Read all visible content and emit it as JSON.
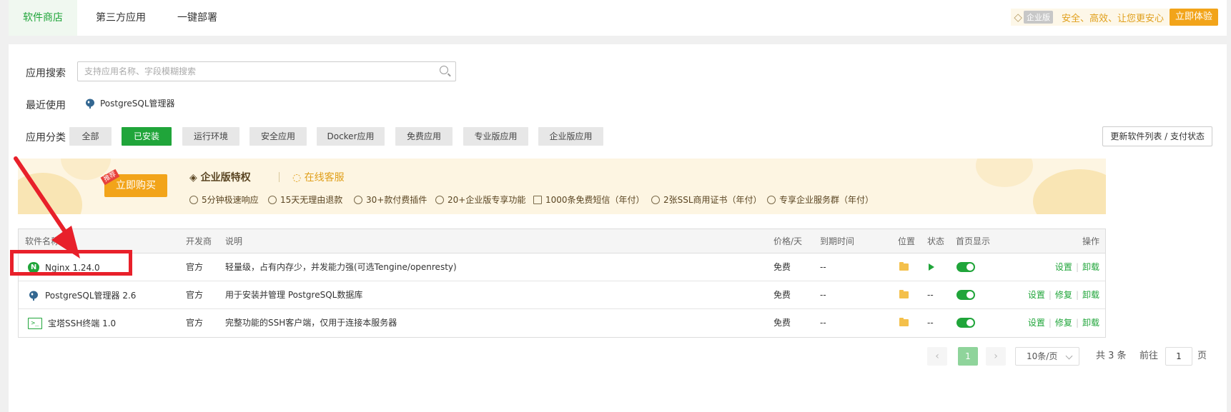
{
  "tabs": [
    {
      "label": "软件商店"
    },
    {
      "label": "第三方应用"
    },
    {
      "label": "一键部署"
    }
  ],
  "promo": {
    "badge_label": "企业版",
    "slogan": "安全、高效、让您更安心",
    "try_label": "立即体验"
  },
  "search": {
    "label": "应用搜索",
    "placeholder": "支持应用名称、字段模糊搜索"
  },
  "recent": {
    "label": "最近使用",
    "items": [
      {
        "name": "PostgreSQL管理器"
      }
    ]
  },
  "categories": {
    "label": "应用分类",
    "items": [
      {
        "label": "全部"
      },
      {
        "label": "已安装",
        "active": true
      },
      {
        "label": "运行环境"
      },
      {
        "label": "安全应用"
      },
      {
        "label": "Docker应用"
      },
      {
        "label": "免费应用"
      },
      {
        "label": "专业版应用"
      },
      {
        "label": "企业版应用"
      }
    ],
    "update_label": "更新软件列表 / 支付状态"
  },
  "banner": {
    "buy_label": "立即购买",
    "hot_tag": "推荐",
    "title": "企业版特权",
    "cs_label": "在线客服",
    "features": [
      "5分钟极速响应",
      "15天无理由退款",
      "30+款付费插件",
      "20+企业版专享功能",
      "1000条免费短信（年付）",
      "2张SSL商用证书（年付）",
      "专享企业服务群（年付）"
    ]
  },
  "table": {
    "headers": {
      "name": "软件名称",
      "developer": "开发商",
      "description": "说明",
      "price": "价格/天",
      "expire": "到期时间",
      "location": "位置",
      "status": "状态",
      "homepage": "首页显示",
      "ops": "操作"
    },
    "rows": [
      {
        "name": "Nginx 1.24.0",
        "developer": "官方",
        "description": "轻量级，占有内存少，并发能力强(可选Tengine/openresty)",
        "price": "免费",
        "expire": "--",
        "status": "",
        "ops": [
          "设置",
          "卸载"
        ]
      },
      {
        "name": "PostgreSQL管理器 2.6",
        "developer": "官方",
        "description": "用于安装并管理 PostgreSQL数据库",
        "price": "免费",
        "expire": "--",
        "status": "--",
        "ops": [
          "设置",
          "修复",
          "卸载"
        ]
      },
      {
        "name": "宝塔SSH终端 1.0",
        "developer": "官方",
        "description": "完整功能的SSH客户端，仅用于连接本服务器",
        "price": "免费",
        "expire": "--",
        "status": "--",
        "ops": [
          "设置",
          "修复",
          "卸载"
        ]
      }
    ]
  },
  "pagination": {
    "prev": "‹",
    "current": "1",
    "next": "›",
    "per_page": "10条/页",
    "total": "共 3 条",
    "goto_label": "前往",
    "goto_value": "1",
    "page_unit": "页"
  },
  "annotation_color": "#e8202a",
  "accent": "#20a53a"
}
